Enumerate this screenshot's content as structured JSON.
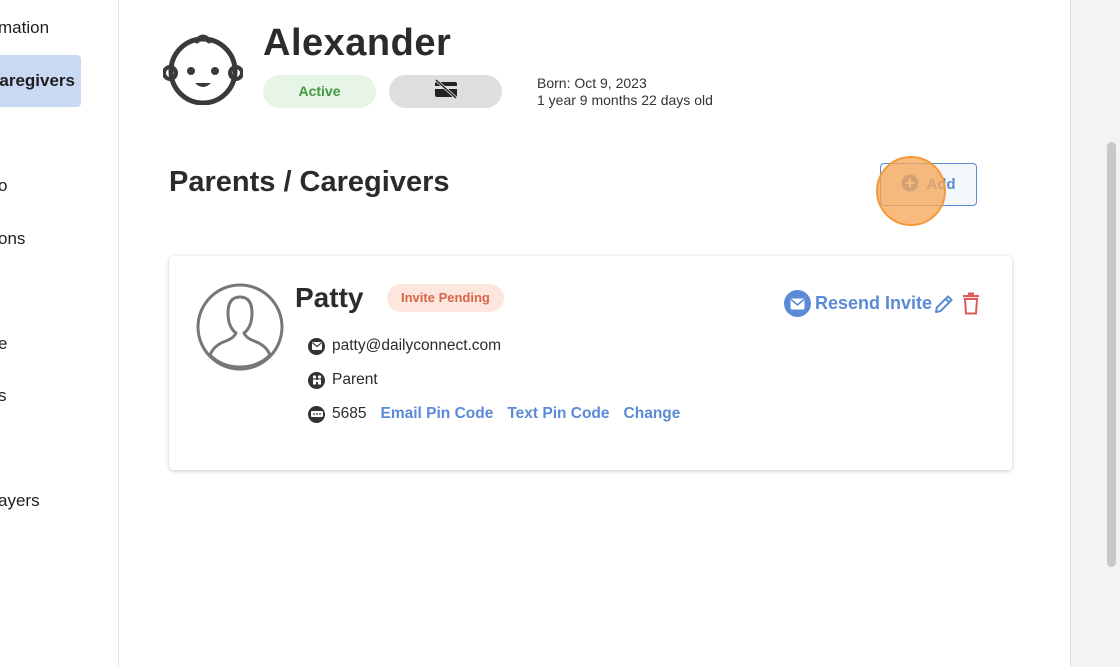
{
  "sidebar": {
    "items": [
      {
        "label": "mation"
      },
      {
        "label": "Caregivers"
      },
      {
        "label": "o"
      },
      {
        "label": "ons"
      },
      {
        "label": "e"
      },
      {
        "label": "s"
      },
      {
        "label": "ayers"
      }
    ]
  },
  "child": {
    "name": "Alexander",
    "status": "Active",
    "born": "Born: Oct 9, 2023",
    "age": "1 year 9 months 22 days old"
  },
  "section": {
    "title": "Parents / Caregivers",
    "add_label": "Add"
  },
  "caregiver": {
    "name": "Patty",
    "status": "Invite Pending",
    "resend_label": "Resend Invite",
    "email": "patty@dailyconnect.com",
    "role": "Parent",
    "pin": "5685",
    "email_pin_label": "Email Pin Code",
    "text_pin_label": "Text Pin Code",
    "change_label": "Change"
  },
  "colors": {
    "accent": "#5b8ad6",
    "active_badge_bg": "#e6f5e6",
    "active_badge_text": "#3f9a3f",
    "pending_badge_bg": "#fde6dd",
    "pending_badge_text": "#d8654a",
    "delete": "#e05a5a",
    "sidebar_active_bg": "#c9d8f3"
  },
  "icons": [
    "baby-face-icon",
    "no-card-icon",
    "plus-circle-icon",
    "person-outline-icon",
    "envelope-icon",
    "pencil-icon",
    "trash-icon",
    "family-icon",
    "pin-dots-icon"
  ]
}
